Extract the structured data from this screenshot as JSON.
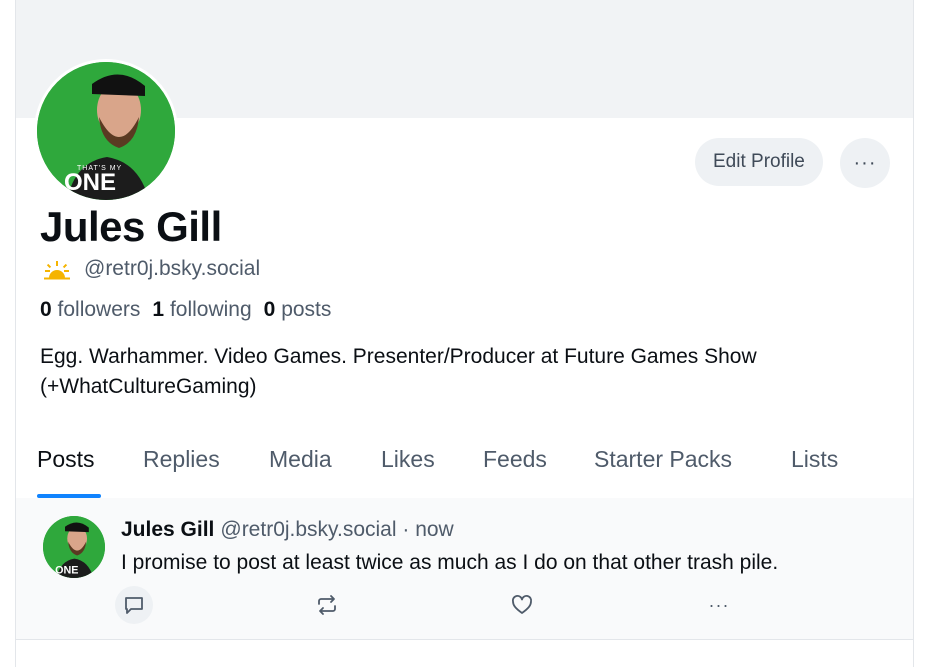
{
  "profile": {
    "display_name": "Jules Gill",
    "handle": "@retr0j.bsky.social",
    "avatar_logo_text": "THAT'S MY ONE",
    "stats": {
      "followers_count": "0",
      "followers_label": "followers",
      "following_count": "1",
      "following_label": "following",
      "posts_count": "0",
      "posts_label": "posts"
    },
    "bio_line1": "Egg. Warhammer. Video Games. Presenter/Producer at Future Games Show",
    "bio_line2": "(+WhatCultureGaming)"
  },
  "actions": {
    "edit_profile_label": "Edit Profile",
    "more_label": "···"
  },
  "tabs": [
    {
      "label": "Posts",
      "active": true
    },
    {
      "label": "Replies"
    },
    {
      "label": "Media"
    },
    {
      "label": "Likes"
    },
    {
      "label": "Feeds"
    },
    {
      "label": "Starter Packs"
    },
    {
      "label": "Lists"
    }
  ],
  "post": {
    "author": "Jules Gill",
    "handle": "@retr0j.bsky.social",
    "meta": "· now",
    "text": "I promise to post at least twice as much as I do on that other trash pile.",
    "action_icons": [
      "reply-icon",
      "repost-icon",
      "like-icon",
      "more-icon"
    ],
    "more_label": "···"
  },
  "colors": {
    "accent": "#1083fe",
    "banner": "#f1f3f5",
    "avatar_bg": "#2fa83c",
    "muted_text": "#4f5b6a",
    "sun": "#f5b400"
  }
}
